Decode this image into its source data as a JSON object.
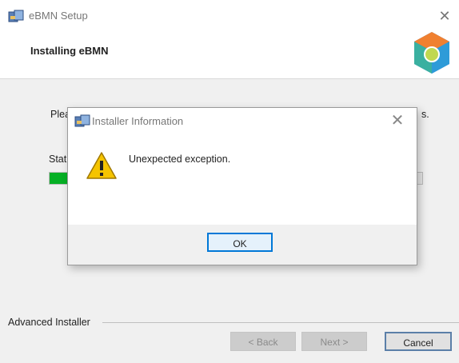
{
  "window": {
    "title": "eBMN Setup",
    "close_glyph": "✕",
    "icon": "installer-package-icon"
  },
  "header": {
    "step_title": "Installing eBMN",
    "logo_icon": "advanced-installer-logo-icon"
  },
  "background": {
    "please_text_fragment": "Plea",
    "please_text_tail": "s.",
    "status_label_fragment": "Stat",
    "progress_fraction": 0.05,
    "progress_color": "#06b025"
  },
  "footer": {
    "brand": "Advanced Installer",
    "back_label": "< Back",
    "next_label": "Next >",
    "cancel_label": "Cancel"
  },
  "dialog": {
    "title": "Installer Information",
    "close_glyph": "✕",
    "icon": "warning-icon",
    "message": "Unexpected exception.",
    "ok_label": "OK"
  }
}
